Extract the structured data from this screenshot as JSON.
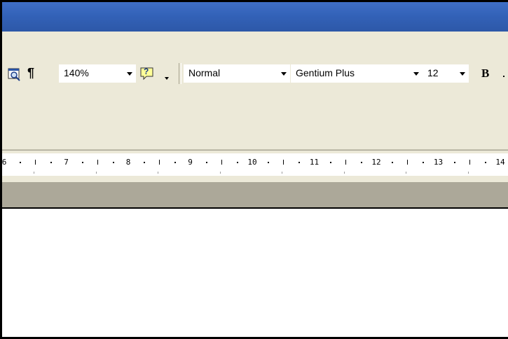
{
  "toolbar": {
    "zoom_value": "140%",
    "paragraph_mark": "¶",
    "help_glyph": "?",
    "style_value": "Normal",
    "font_value": "Gentium Plus",
    "size_value": "12",
    "bold_label": "B"
  },
  "ruler": {
    "labels": [
      "6",
      "7",
      "8",
      "9",
      "10",
      "11",
      "12",
      "13",
      "14"
    ]
  },
  "colors": {
    "titlebar": "#3362b8",
    "chrome": "#ece9d8",
    "gray_band": "#aca899"
  }
}
